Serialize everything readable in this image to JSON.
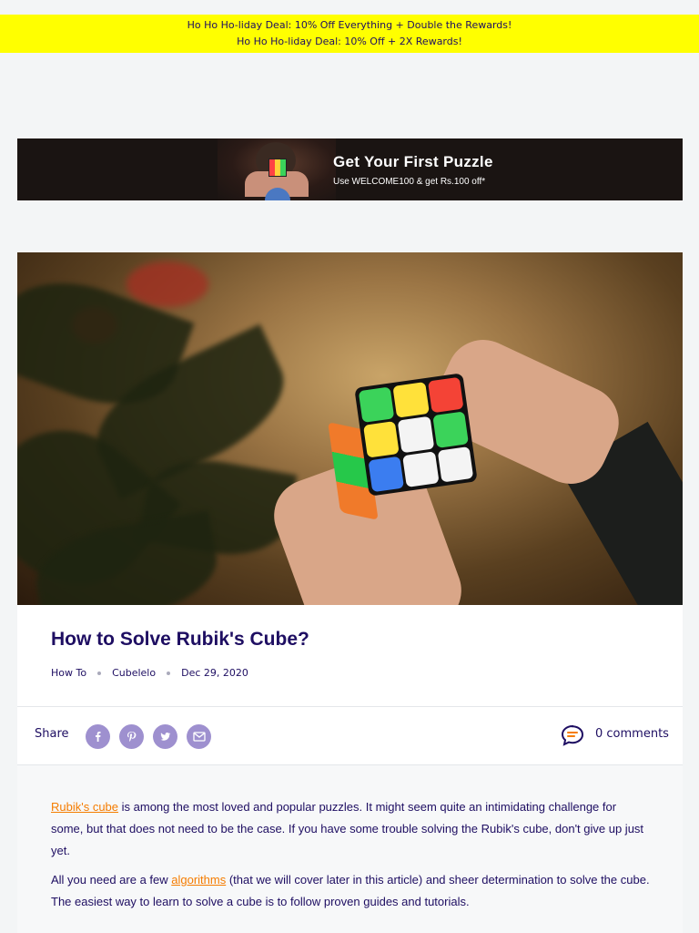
{
  "announcement": {
    "line1": "Ho Ho Ho-liday Deal: 10% Off Everything + Double the Rewards!",
    "line2": "Ho Ho Ho-liday Deal: 10% Off + 2X Rewards!"
  },
  "promo": {
    "title": "Get Your First Puzzle",
    "subtitle": "Use WELCOME100 & get Rs.100 off*"
  },
  "article": {
    "title": "How to Solve Rubik's Cube?",
    "category": "How To",
    "author": "Cubelelo",
    "date": "Dec 29, 2020",
    "share_label": "Share",
    "share_icons": [
      "facebook-icon",
      "pinterest-icon",
      "twitter-icon",
      "email-icon"
    ],
    "comments": "0 comments",
    "p1_link": "Rubik's cube",
    "p1_rest": " is among the most loved and popular puzzles. It might seem quite an intimidating challenge for some, but that does not need to be the case. If you have some trouble solving the Rubik's cube, don't give up just yet.",
    "p2_start": "All you need are a few ",
    "p2_link": "algorithms",
    "p2_rest": " (that we will cover later in this article) and sheer determination to solve the cube. The easiest way to learn to solve a cube is to follow proven guides and tutorials."
  },
  "colors": {
    "accent": "#1e0e62",
    "link": "#f57c00",
    "banner": "#ffff00",
    "share_icon_bg": "#9e90cf"
  }
}
